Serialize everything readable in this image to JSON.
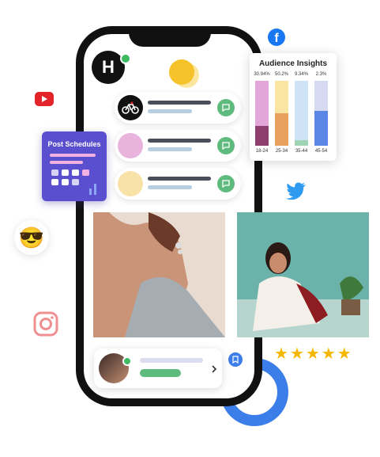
{
  "insights": {
    "title": "Audience Insights",
    "bars": [
      {
        "pct_label": "30.94%",
        "age": "18-24",
        "fill": 0.31,
        "top_color": "#e3a6d8",
        "fill_color": "#8e3f6e"
      },
      {
        "pct_label": "50.2%",
        "age": "25-34",
        "fill": 0.5,
        "top_color": "#fae5a2",
        "fill_color": "#e8a15c"
      },
      {
        "pct_label": "9.34%",
        "age": "35-44",
        "fill": 0.09,
        "top_color": "#cfe3f7",
        "fill_color": "#9fd4b4"
      },
      {
        "pct_label": "2.3%",
        "age": "45-54",
        "fill": 0.54,
        "top_color": "#d5daf2",
        "fill_color": "#5b86e5"
      }
    ]
  },
  "schedules": {
    "title": "Post Schedules"
  },
  "app_logo": {
    "letter": "H"
  },
  "colors": {
    "accent_blue": "#3b7de9",
    "accent_green": "#5fba7d",
    "phone_frame": "#111111"
  },
  "icons": [
    "facebook-icon",
    "youtube-icon",
    "twitter-icon",
    "instagram-icon",
    "sunglasses-emoji",
    "bookmark-icon",
    "chevron-right-icon",
    "chat-bubble-icon"
  ],
  "rating": {
    "stars": 5
  }
}
